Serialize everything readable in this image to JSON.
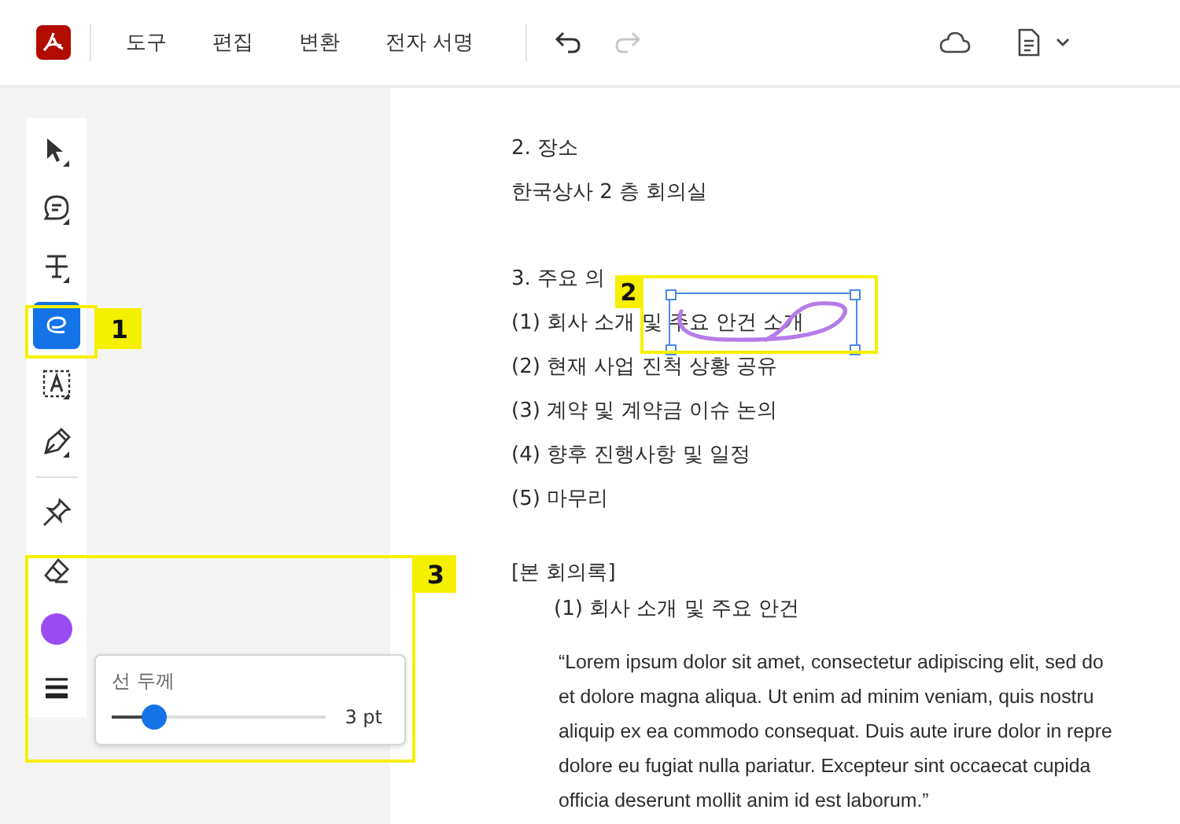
{
  "menu": [
    {
      "label": "도구"
    },
    {
      "label": "편집"
    },
    {
      "label": "변환"
    },
    {
      "label": "전자 서명"
    }
  ],
  "history": [
    {
      "kind": "undo",
      "disabled": false
    },
    {
      "kind": "redo",
      "disabled": true
    }
  ],
  "tools": [
    {
      "kind": "select",
      "selected": false,
      "submenu": true
    },
    {
      "kind": "comment",
      "selected": false,
      "submenu": true
    },
    {
      "kind": "strike",
      "selected": false,
      "submenu": true
    },
    {
      "kind": "draw",
      "selected": true,
      "submenu": false
    },
    {
      "kind": "textbox",
      "selected": false,
      "submenu": true
    },
    {
      "kind": "pen",
      "selected": false,
      "submenu": true
    },
    {
      "kind": "divider"
    },
    {
      "kind": "pin",
      "selected": false,
      "submenu": false
    },
    {
      "kind": "eraser",
      "selected": false,
      "submenu": false
    },
    {
      "kind": "color",
      "color": "#9b4bf2"
    },
    {
      "kind": "thickness",
      "selected": false,
      "submenu": false
    }
  ],
  "thickness_popup": {
    "label": "선 두께",
    "level": 0.2,
    "reading": "3 pt"
  },
  "document": {
    "lines": [
      {
        "kind": "text",
        "text": "2. 장소"
      },
      {
        "kind": "text",
        "text": "한국상사 2 층 회의실"
      },
      {
        "kind": "gap"
      },
      {
        "kind": "text",
        "text": "3. 주요 의"
      },
      {
        "kind": "text",
        "text": "(1) 회사 소개 및 주요 안건 소개"
      },
      {
        "kind": "text",
        "text": "(2) 현재 사업 진척 상황 공유"
      },
      {
        "kind": "text",
        "text": "(3) 계약 및 계약금 이슈 논의"
      },
      {
        "kind": "text",
        "text": "(4) 향후 진행사항 및 일정"
      },
      {
        "kind": "text",
        "text": "(5) 마무리"
      },
      {
        "kind": "gap"
      },
      {
        "kind": "text",
        "text": "[본 회의록]"
      },
      {
        "kind": "sub",
        "text": "(1)  회사 소개 및 주요 안건"
      },
      {
        "kind": "gap"
      },
      {
        "kind": "para",
        "text": "“Lorem ipsum dolor sit amet, consectetur adipiscing elit, sed do"
      },
      {
        "kind": "para",
        "text": "et dolore magna aliqua. Ut enim ad minim veniam, quis nostru"
      },
      {
        "kind": "para",
        "text": "aliquip ex ea commodo consequat. Duis aute irure dolor in repre"
      },
      {
        "kind": "para",
        "text": "dolore eu fugiat nulla pariatur. Excepteur sint occaecat cupida"
      },
      {
        "kind": "para",
        "text": "officia deserunt mollit anim id est laborum.”"
      }
    ]
  },
  "annotation": {
    "color": "#b57be8"
  },
  "callouts": [
    {
      "label": "1"
    },
    {
      "label": "2"
    },
    {
      "label": "3"
    }
  ]
}
